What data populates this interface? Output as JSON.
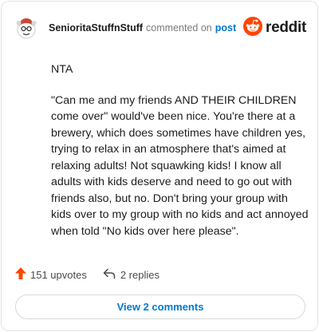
{
  "comment": {
    "username": "SenioritaStuffnStuff",
    "action": "commented on",
    "target": "post",
    "paragraphs": [
      "NTA",
      "\"Can me and my friends AND THEIR CHILDREN come over\" would've been nice. You're there at a brewery, which does sometimes have children yes, trying to relax in an atmosphere that's aimed at relaxing adults! Not squawking kids! I know all adults with kids deserve and need to go out with friends also, but no. Don't bring your group with kids over to my group with no kids and act annoyed when told \"No kids over here please\"."
    ]
  },
  "brand": {
    "name": "reddit",
    "color": "#ff4500"
  },
  "stats": {
    "upvotes": "151 upvotes",
    "replies": "2 replies"
  },
  "view_comments_label": "View 2 comments",
  "icons": {
    "avatar": "snoo-avatar-icon",
    "logo": "reddit-logo-icon",
    "upvote": "upvote-arrow-icon",
    "reply": "reply-arrow-icon"
  },
  "colors": {
    "link": "#0079d3",
    "upvote": "#ff4500",
    "text": "#1c1c1c",
    "muted": "#7c7c7c"
  }
}
